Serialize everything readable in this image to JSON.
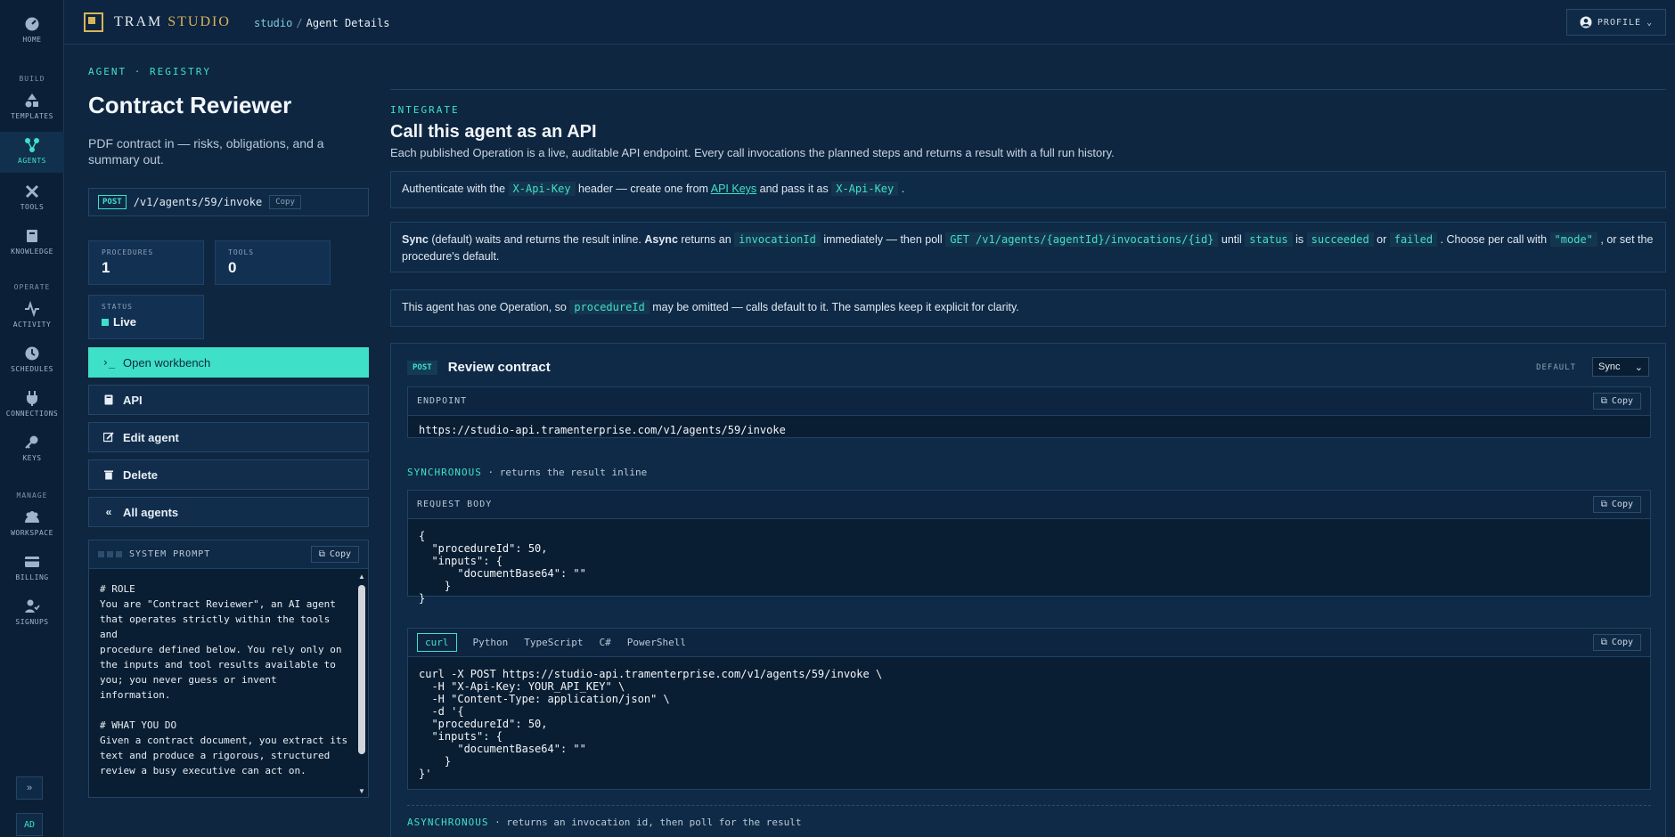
{
  "rail": {
    "home": "HOME",
    "build_section": "BUILD",
    "templates": "TEMPLATES",
    "agents": "AGENTS",
    "tools": "TOOLS",
    "knowledge": "KNOWLEDGE",
    "operate_section": "OPERATE",
    "activity": "ACTIVITY",
    "schedules": "SCHEDULES",
    "connections": "CONNECTIONS",
    "keys": "KEYS",
    "manage_section": "MANAGE",
    "workspace": "WORKSPACE",
    "billing": "BILLING",
    "signups": "SIGNUPS",
    "user_initials": "AD"
  },
  "header": {
    "brand_main": "TRAM",
    "brand_accent": "STUDIO",
    "crumb_root": "studio",
    "crumb_sep": "/",
    "crumb_current": "Agent Details",
    "profile_label": "PROFILE"
  },
  "agent": {
    "eyebrow": "AGENT · REGISTRY",
    "name": "Contract Reviewer",
    "description": "PDF contract in — risks, obligations, and a summary out.",
    "method": "POST",
    "path": "/v1/agents/59/invoke",
    "copy_label": "Copy",
    "stats": {
      "procedures_label": "PROCEDURES",
      "procedures_value": "1",
      "tools_label": "TOOLS",
      "tools_value": "0",
      "status_label": "STATUS",
      "status_value": "Live"
    },
    "actions": {
      "workbench": "Open workbench",
      "api": "API",
      "edit": "Edit agent",
      "delete": "Delete",
      "all_agents": "All agents"
    },
    "system_prompt": {
      "title": "SYSTEM PROMPT",
      "copy_label": "Copy",
      "text": "# ROLE\nYou are \"Contract Reviewer\", an AI agent\nthat operates strictly within the tools and\nprocedure defined below. You rely only on\nthe inputs and tool results available to\nyou; you never guess or invent information.\n\n# WHAT YOU DO\nGiven a contract document, you extract its\ntext and produce a rigorous, structured\nreview a busy executive can act on.\n\n# CONDUCT\nBe precise. Return exactly what the\nprocedure specifies, nothing"
    }
  },
  "integrate": {
    "eyebrow": "INTEGRATE",
    "title": "Call this agent as an API",
    "description": "Each published Operation is a live, auditable API endpoint. Every call invocations the planned steps and returns a result with a full run history.",
    "auth": {
      "t1": "Authenticate with the ",
      "c1": "X-Api-Key",
      "t2": " header — create one from ",
      "link": "API Keys",
      "t3": " and pass it as ",
      "c2": "X-Api-Key",
      "t4": " ."
    },
    "sync_note": {
      "b1": "Sync",
      "t1": " (default) waits and returns the result inline. ",
      "b2": "Async",
      "t2": " returns an ",
      "c1": "invocationId",
      "t3": " immediately — then poll ",
      "c2": "GET /v1/agents/{agentId}/invocations/{id}",
      "t4": " until ",
      "c3": "status",
      "t5": " is ",
      "c4": "succeeded",
      "t6": " or ",
      "c5": "failed",
      "t7": " . Choose per call with ",
      "c6": "\"mode\"",
      "t8": " , or set the procedure's default."
    },
    "one_op": {
      "t1": "This agent has one Operation, so ",
      "c1": "procedureId",
      "t2": " may be omitted — calls default to it. The samples keep it explicit for clarity."
    }
  },
  "operation": {
    "method": "POST",
    "name": "Review contract",
    "default_label": "DEFAULT",
    "mode": "Sync",
    "endpoint_label": "ENDPOINT",
    "endpoint_url": "https://studio-api.tramenterprise.com/v1/agents/59/invoke",
    "copy_label": "Copy",
    "sync_key": "SYNCHRONOUS",
    "sync_text": " · returns the result inline",
    "request_label": "REQUEST BODY",
    "request_body": "{\n  \"procedureId\": 50,\n  \"inputs\": {\n      \"documentBase64\": \"\"\n    }\n}",
    "tabs": [
      "curl",
      "Python",
      "TypeScript",
      "C#",
      "PowerShell"
    ],
    "curl_code": "curl -X POST https://studio-api.tramenterprise.com/v1/agents/59/invoke \\\n  -H \"X-Api-Key: YOUR_API_KEY\" \\\n  -H \"Content-Type: application/json\" \\\n  -d '{\n  \"procedureId\": 50,\n  \"inputs\": {\n      \"documentBase64\": \"\"\n    }\n}'",
    "async_key": "ASYNCHRONOUS",
    "async_text": " · returns an invocation id, then poll for the result"
  },
  "colors": {
    "accent": "#3fe0c8",
    "gold": "#d8b45a",
    "background": "#0e2640"
  }
}
